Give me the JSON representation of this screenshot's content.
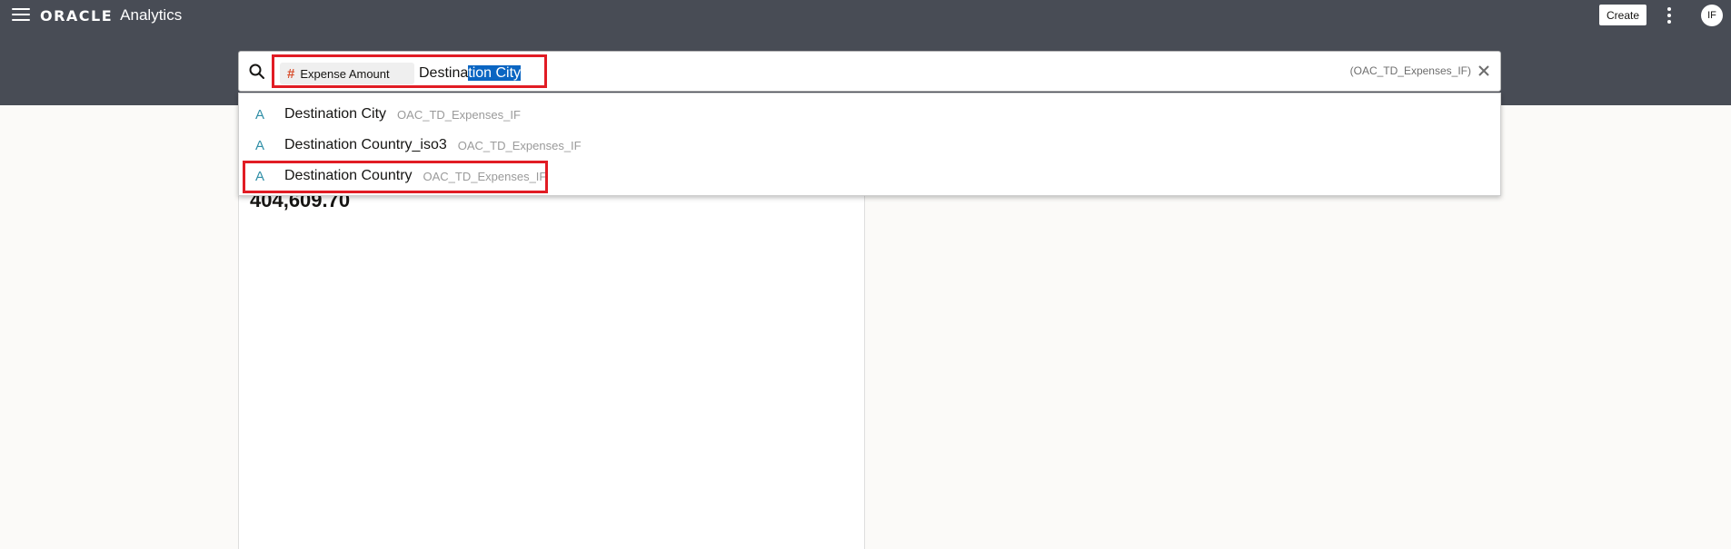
{
  "header": {
    "logo_oracle": "ORACLE",
    "logo_analytics": "Analytics",
    "create_label": "Create",
    "avatar_initials": "IF"
  },
  "search": {
    "token_label": "Expense Amount",
    "text_before": "Destina",
    "text_selected": "tion City",
    "subject_area": "(OAC_TD_Expenses_IF)"
  },
  "dropdown": {
    "options": [
      {
        "icon": "A",
        "name": "Destination City",
        "source": "OAC_TD_Expenses_IF"
      },
      {
        "icon": "A",
        "name": "Destination Country_iso3",
        "source": "OAC_TD_Expenses_IF"
      },
      {
        "icon": "A",
        "name": "Destination Country",
        "source": "OAC_TD_Expenses_IF"
      }
    ]
  },
  "canvas": {
    "metric_value": "404,609.70"
  },
  "colors": {
    "header_bg": "#484c55",
    "highlight_border": "#e11c24",
    "selection": "#0a65c2",
    "attribute_icon": "#2f8ea6",
    "measure_icon": "#d8502f"
  }
}
